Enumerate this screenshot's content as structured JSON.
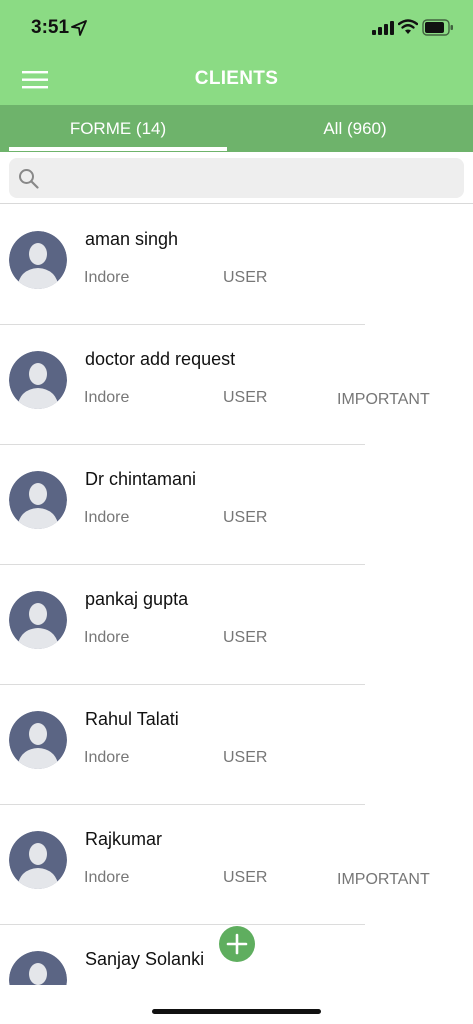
{
  "status_bar": {
    "time": "3:51",
    "icons": [
      "location-arrow-icon",
      "cellular-signal-icon",
      "wifi-icon",
      "battery-icon"
    ]
  },
  "header": {
    "title": "CLIENTS",
    "menu_icon": "hamburger-menu-icon",
    "background_color": "#8bdb84"
  },
  "tabs": [
    {
      "label": "FORME (14)",
      "selected": true
    },
    {
      "label": "All (960)",
      "selected": false
    }
  ],
  "search": {
    "placeholder": "",
    "value": "",
    "icon": "search-icon"
  },
  "clients": [
    {
      "name": "aman singh",
      "city": "Indore",
      "role": "USER",
      "flag": ""
    },
    {
      "name": "doctor add request",
      "city": "Indore",
      "role": "USER",
      "flag": "IMPORTANT"
    },
    {
      "name": "Dr chintamani",
      "city": "Indore",
      "role": "USER",
      "flag": ""
    },
    {
      "name": "pankaj gupta",
      "city": "Indore",
      "role": "USER",
      "flag": ""
    },
    {
      "name": "Rahul Talati",
      "city": "Indore",
      "role": "USER",
      "flag": ""
    },
    {
      "name": "Rajkumar",
      "city": "Indore",
      "role": "USER",
      "flag": "IMPORTANT"
    },
    {
      "name": "Sanjay Solanki",
      "city": "",
      "role": "",
      "flag": ""
    }
  ],
  "fab": {
    "icon": "plus-icon",
    "color": "#5fae5f"
  },
  "colors": {
    "tab_bar": "#6eb36b",
    "avatar_bg": "#5b6584",
    "avatar_fg": "#e4e6ea"
  }
}
